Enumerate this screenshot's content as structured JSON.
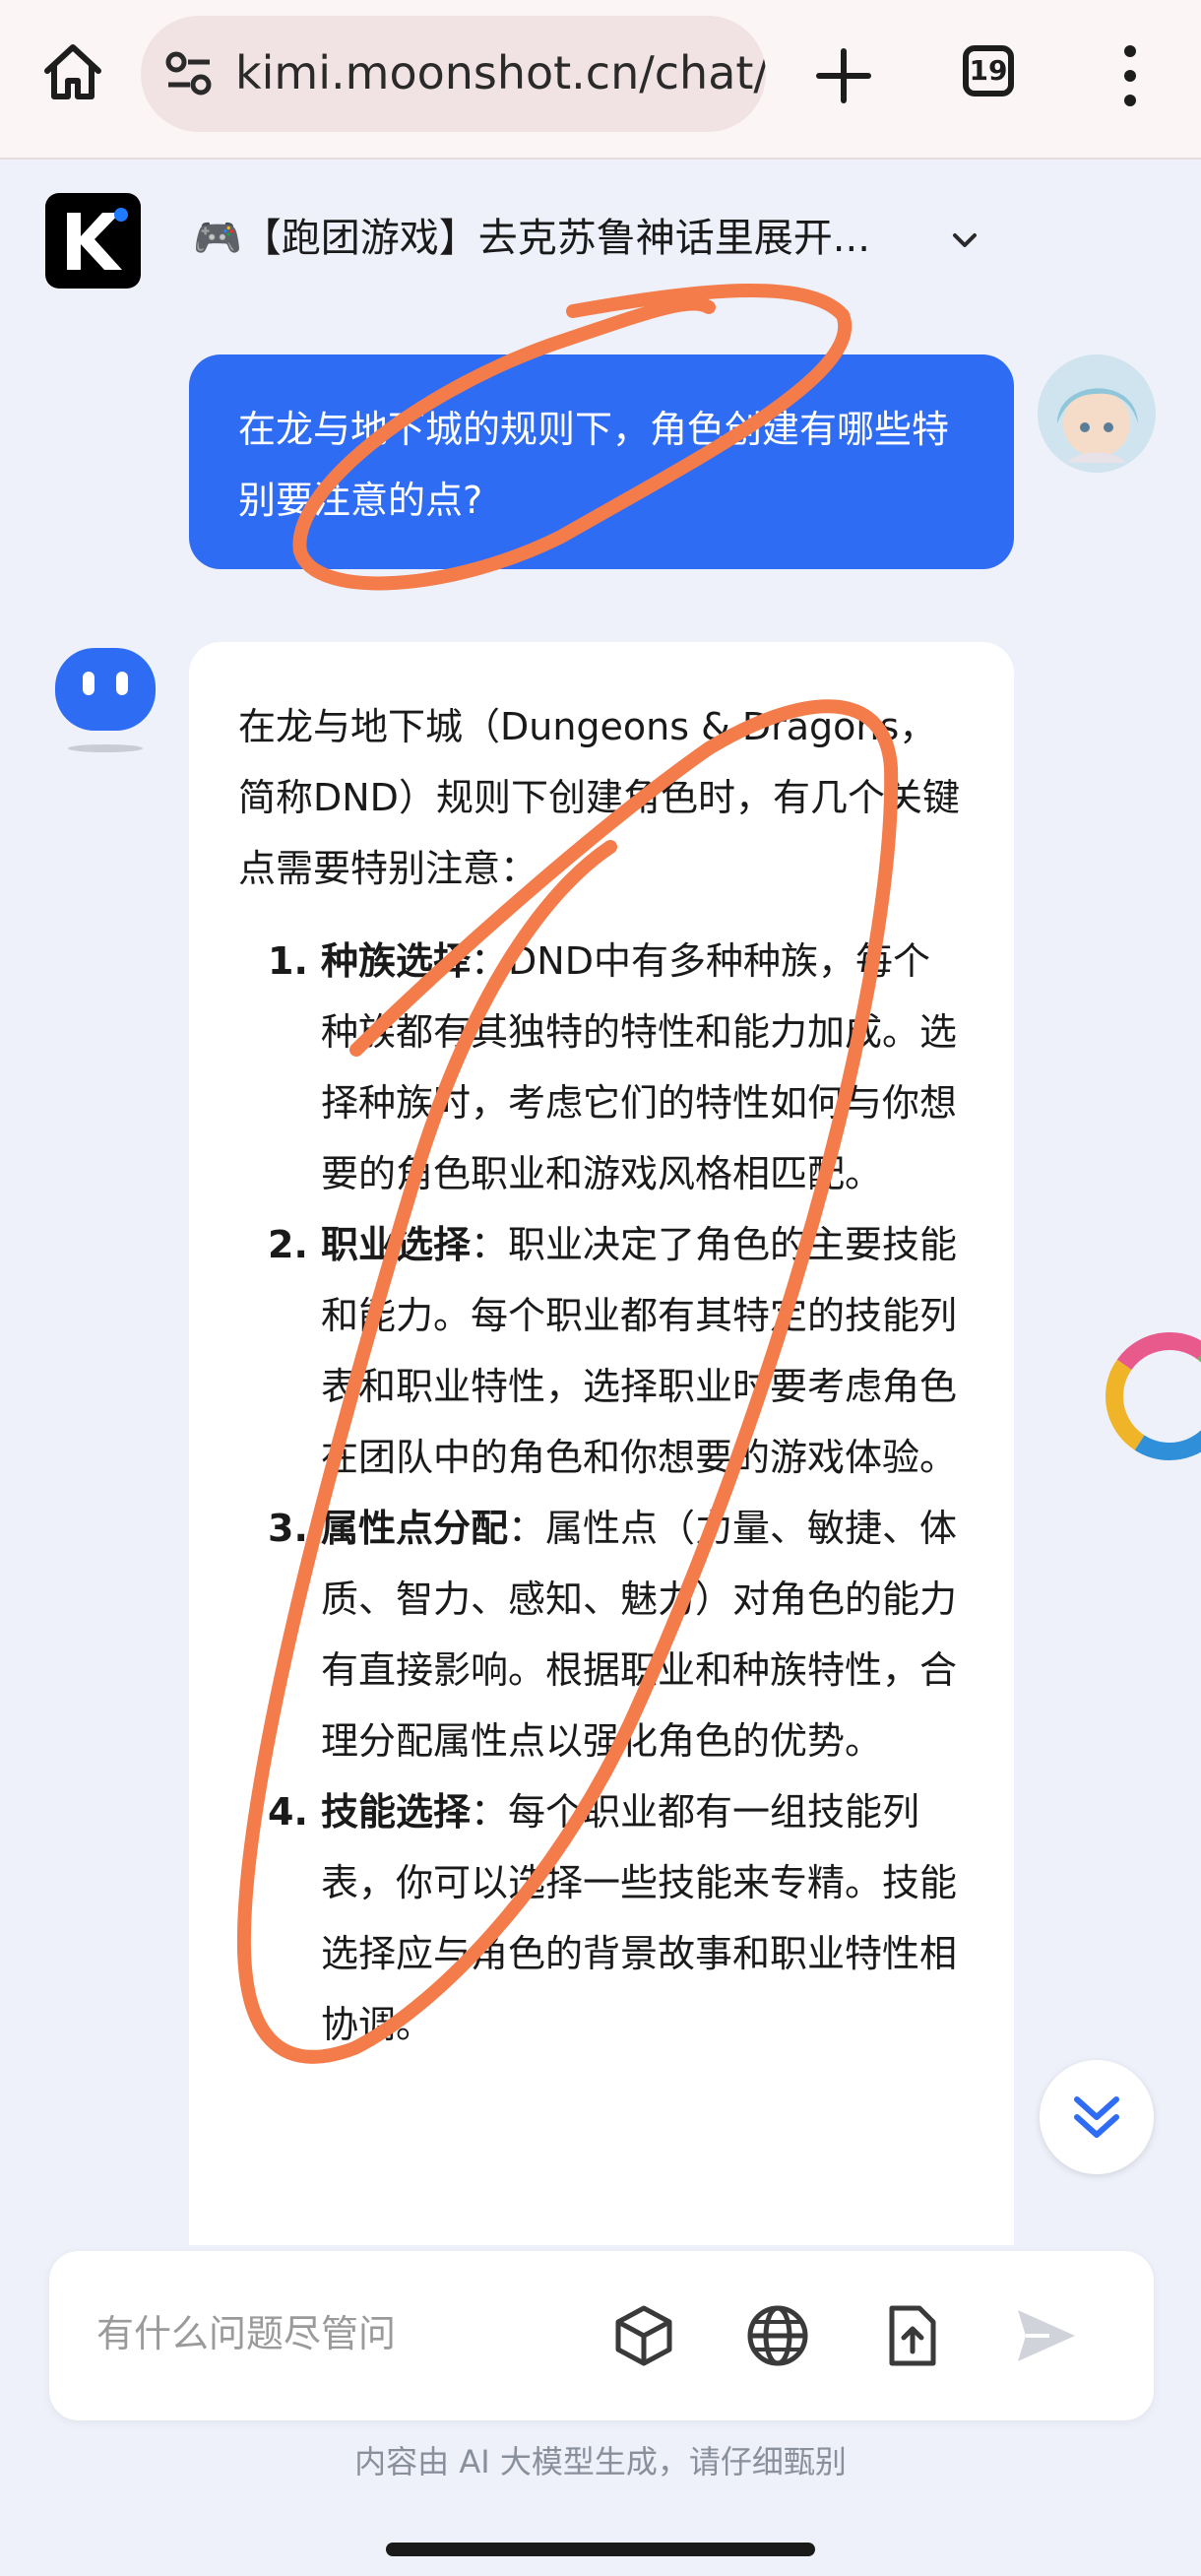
{
  "browser": {
    "url": "kimi.moonshot.cn/chat/",
    "tab_count": "19",
    "icons": [
      "home-icon",
      "site-settings-icon",
      "new-tab-icon",
      "tab-switcher-icon",
      "more-menu-icon"
    ]
  },
  "chat": {
    "title": "🎮【跑团游戏】去克苏鲁神话里展开...",
    "user_message": "在龙与地下城的规则下，角色创建有哪些特别要注意的点?",
    "ai_intro": "在龙与地下城（Dungeons & Dragons，简称DND）规则下创建角色时，有几个关键点需要特别注意：",
    "ai_items": [
      {
        "num": "1.",
        "heading": "种族选择",
        "text": "：DND中有多种种族，每个种族都有其独特的特性和能力加成。选择种族时，考虑它们的特性如何与你想要的角色职业和游戏风格相匹配。"
      },
      {
        "num": "2.",
        "heading": "职业选择",
        "text": "：职业决定了角色的主要技能和能力。每个职业都有其特定的技能列表和职业特性，选择职业时要考虑角色在团队中的角色和你想要的游戏体验。"
      },
      {
        "num": "3.",
        "heading": "属性点分配",
        "text": "：属性点（力量、敏捷、体质、智力、感知、魅力）对角色的能力有直接影响。根据职业和种族特性，合理分配属性点以强化角色的优势。"
      },
      {
        "num": "4.",
        "heading": "技能选择",
        "text": "：每个职业都有一组技能列表，你可以选择一些技能来专精。技能选择应与角色的背景故事和职业特性相协调。"
      }
    ]
  },
  "composer": {
    "placeholder": "有什么问题尽管问",
    "tools": [
      "cube-icon",
      "globe-icon",
      "upload-file-icon",
      "send-icon"
    ]
  },
  "disclaimer": "内容由 AI 大模型生成，请仔细甄别",
  "colors": {
    "user_bubble": "#2f6cf4",
    "background": "#eef1fa",
    "annotation": "#f47c4a"
  }
}
